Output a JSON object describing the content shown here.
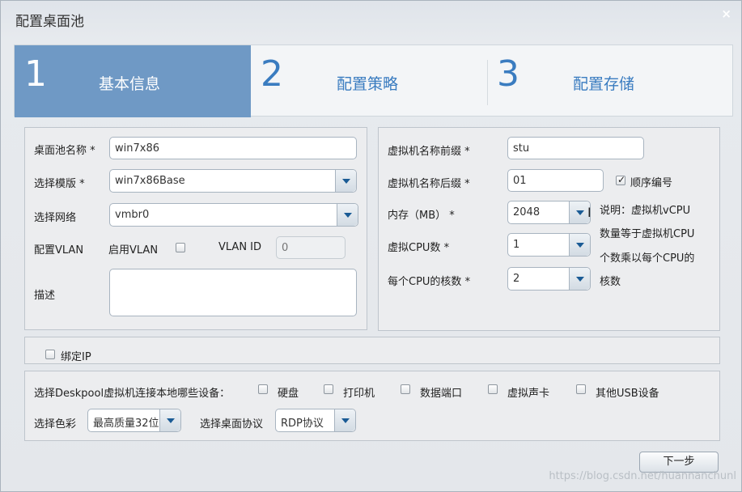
{
  "window": {
    "title": "配置桌面池",
    "close_glyph": "×"
  },
  "steps": [
    {
      "num": "1",
      "label": "基本信息"
    },
    {
      "num": "2",
      "label": "配置策略"
    },
    {
      "num": "3",
      "label": "配置存储"
    }
  ],
  "left": {
    "pool_name_label": "桌面池名称 *",
    "pool_name_value": "win7x86",
    "template_label": "选择模版 *",
    "template_value": "win7x86Base",
    "network_label": "选择网络",
    "network_value": "vmbr0",
    "vlan_label": "配置VLAN",
    "enable_vlan_label": "启用VLAN",
    "vlan_id_label": "VLAN ID",
    "vlan_id_placeholder": "0",
    "desc_label": "描述"
  },
  "right": {
    "prefix_label": "虚拟机名称前缀 *",
    "prefix_value": "stu",
    "suffix_label": "虚拟机名称后缀 *",
    "suffix_value": "01",
    "seq_label": "顺序编号",
    "memory_label": "内存（MB） *",
    "memory_value": "2048",
    "cpu_label": "虚拟CPU数 *",
    "cpu_value": "1",
    "cores_label": "每个CPU的核数 *",
    "cores_value": "2",
    "note_lines": [
      "说明：虚拟机vCPU",
      "数量等于虚拟机CPU",
      "个数乘以每个CPU的",
      "核数"
    ]
  },
  "bind_ip": {
    "label": "绑定IP"
  },
  "devices": {
    "prompt": "选择Deskpool虚拟机连接本地哪些设备：",
    "items": [
      "硬盘",
      "打印机",
      "数据端口",
      "虚拟声卡",
      "其他USB设备"
    ],
    "color_label": "选择色彩",
    "color_value": "最高质量32位",
    "protocol_label": "选择桌面协议",
    "protocol_value": "RDP协议"
  },
  "footer": {
    "next_button": "下一步",
    "watermark": "https://blog.csdn.net/huannanchunl"
  }
}
